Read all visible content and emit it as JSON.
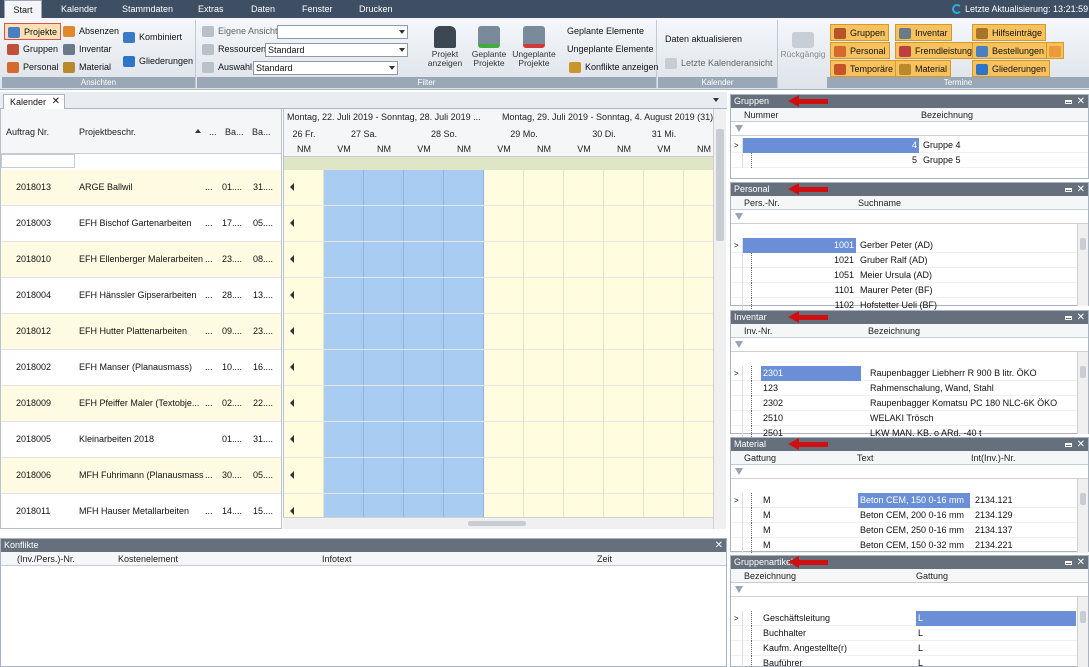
{
  "menu": {
    "tabs": [
      "Start",
      "Kalender",
      "Stammdaten",
      "Extras",
      "Daten",
      "Fenster",
      "Drucken"
    ],
    "status": "Letzte Aktualisierung: 13:21:59"
  },
  "ribbon": {
    "ansichten": {
      "label": "Ansichten",
      "projekte": "Projekte",
      "absenzen": "Absenzen",
      "kombiniert": "Kombiniert",
      "gruppen": "Gruppen",
      "inventar": "Inventar",
      "gliederungen": "Gliederungen",
      "personal": "Personal",
      "material": "Material"
    },
    "filter": {
      "label": "Filter",
      "eigene_ansicht": "Eigene Ansicht",
      "ressourcen": "Ressourcen",
      "ressourcen_value": "Standard",
      "auswahl": "Auswahl",
      "auswahl_value": "Standard",
      "projekt_anzeigen": "Projekt anzeigen",
      "geplante_projekte": "Geplante Projekte",
      "ungeplante_projekte": "Ungeplante Projekte",
      "geplante_elemente": "Geplante Elemente",
      "ungeplante_elemente": "Ungeplante Elemente",
      "konflikte_anzeigen": "Konflikte anzeigen"
    },
    "kalender": {
      "label": "Kalender",
      "daten_aktualisieren": "Daten aktualisieren",
      "letzte_kalenderansicht": "Letzte Kalenderansicht",
      "rueckgaengig": "Rückgängig"
    },
    "termine": {
      "label": "Termine",
      "gruppen": "Gruppen",
      "inventar": "Inventar",
      "hilfseintraege": "Hilfseinträge",
      "personal": "Personal",
      "fremdleistung": "Fremdleistung",
      "bestellungen": "Bestellungen",
      "temporaere": "Temporäre",
      "material": "Material",
      "gliederungen": "Gliederungen"
    }
  },
  "kalender": {
    "tab": "Kalender",
    "columns": [
      "Auftrag Nr.",
      "Projektbeschr.",
      "...",
      "Ba...",
      "Ba..."
    ],
    "weeks": [
      "Montag, 22. Juli 2019 - Sonntag, 28. Juli 2019 ...",
      "Montag, 29. Juli 2019 - Sonntag, 4. August 2019 (31)"
    ],
    "days": [
      "26 Fr.",
      "27 Sa.",
      "28 So.",
      "29 Mo.",
      "30 Di.",
      "31 Mi."
    ],
    "halves": [
      "NM",
      "VM",
      "NM",
      "VM",
      "NM",
      "VM",
      "NM",
      "VM",
      "NM",
      "VM",
      "NM"
    ],
    "rows": [
      {
        "nr": "2018013",
        "desc": "ARGE Ballwil",
        "c3": "...",
        "b1": "01....",
        "b2": "31...."
      },
      {
        "nr": "2018003",
        "desc": "EFH Bischof Gartenarbeiten",
        "c3": "...",
        "b1": "17....",
        "b2": "05...."
      },
      {
        "nr": "2018010",
        "desc": "EFH Ellenberger Malerarbeiten",
        "c3": "...",
        "b1": "23....",
        "b2": "08...."
      },
      {
        "nr": "2018004",
        "desc": "EFH Hänssler Gipserarbeiten",
        "c3": "...",
        "b1": "28....",
        "b2": "13...."
      },
      {
        "nr": "2018012",
        "desc": "EFH Hutter Plattenarbeiten",
        "c3": "...",
        "b1": "09....",
        "b2": "23...."
      },
      {
        "nr": "2018002",
        "desc": "EFH Manser (Planausmass)",
        "c3": "...",
        "b1": "10....",
        "b2": "16...."
      },
      {
        "nr": "2018009",
        "desc": "EFH Pfeiffer Maler (Textobje...",
        "c3": "...",
        "b1": "02....",
        "b2": "22...."
      },
      {
        "nr": "2018005",
        "desc": "Kleinarbeiten 2018",
        "c3": "",
        "b1": "01....",
        "b2": "31...."
      },
      {
        "nr": "2018006",
        "desc": "MFH Fuhrimann (Planausmass)",
        "c3": "...",
        "b1": "30....",
        "b2": "05...."
      },
      {
        "nr": "2018011",
        "desc": "MFH Hauser Metallarbeiten",
        "c3": "...",
        "b1": "14....",
        "b2": "15...."
      }
    ]
  },
  "konflikte": {
    "title": "Konflikte",
    "columns": [
      "(Inv./Pers.)-Nr.",
      "Kostenelement",
      "Infotext",
      "Zeit"
    ]
  },
  "gruppen": {
    "title": "Gruppen",
    "columns": [
      "Nummer",
      "Bezeichnung"
    ],
    "rows": [
      {
        "a": "4",
        "b": "Gruppe 4"
      },
      {
        "a": "5",
        "b": "Gruppe 5"
      }
    ]
  },
  "personal": {
    "title": "Personal",
    "columns": [
      "Pers.-Nr.",
      "Suchname"
    ],
    "rows": [
      {
        "a": "1001",
        "b": "Gerber Peter (AD)"
      },
      {
        "a": "1021",
        "b": "Gruber Ralf (AD)"
      },
      {
        "a": "1051",
        "b": "Meier Ursula (AD)"
      },
      {
        "a": "1101",
        "b": "Maurer Peter (BF)"
      },
      {
        "a": "1102",
        "b": "Hofstetter Ueli (BF)"
      }
    ]
  },
  "inventar": {
    "title": "Inventar",
    "columns": [
      "Inv.-Nr.",
      "Bezeichnung"
    ],
    "rows": [
      {
        "a": "2301",
        "b": "Raupenbagger Liebherr R 900 B litr. ÖKO"
      },
      {
        "a": "123",
        "b": "Rahmenschalung, Wand, Stahl"
      },
      {
        "a": "2302",
        "b": "Raupenbagger Komatsu PC 180 NLC-6K ÖKO"
      },
      {
        "a": "2510",
        "b": "WELAKI Trösch"
      },
      {
        "a": "2501",
        "b": "LKW MAN. KB. o ARd. -40 t"
      }
    ]
  },
  "material": {
    "title": "Material",
    "columns": [
      "Gattung",
      "Text",
      "Int(Inv.)-Nr."
    ],
    "rows": [
      {
        "a": "M",
        "b": "Beton CEM, 150  0-16 mm",
        "c": "2134.121"
      },
      {
        "a": "M",
        "b": "Beton CEM, 200  0-16 mm",
        "c": "2134.129"
      },
      {
        "a": "M",
        "b": "Beton CEM, 250  0-16 mm",
        "c": "2134.137"
      },
      {
        "a": "M",
        "b": "Beton CEM, 150  0-32 mm",
        "c": "2134.221"
      }
    ]
  },
  "gruppenartikel": {
    "title": "Gruppenartikel",
    "columns": [
      "Bezeichnung",
      "Gattung"
    ],
    "rows": [
      {
        "a": "Geschäftsleitung",
        "b": "L"
      },
      {
        "a": "Buchhalter",
        "b": "L"
      },
      {
        "a": "Kaufm. Angestellte(r)",
        "b": "L"
      },
      {
        "a": "Bauführer",
        "b": "L"
      }
    ]
  }
}
